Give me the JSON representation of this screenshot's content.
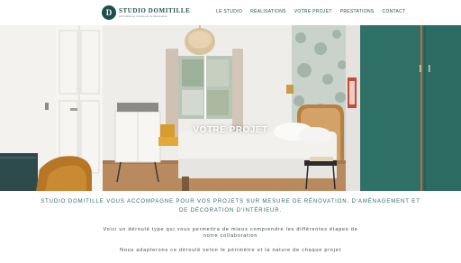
{
  "header": {
    "logo": {
      "initial": "D",
      "name": "STUDIO DOMITILLE",
      "tagline": "Architecture intérieure & décoration"
    },
    "nav": [
      {
        "label": "LE STUDIO"
      },
      {
        "label": "RÉALISATIONS"
      },
      {
        "label": "VOTRE PROJET"
      },
      {
        "label": "PRESTATIONS"
      },
      {
        "label": "CONTACT"
      }
    ]
  },
  "hero": {
    "title": "VOTRE PROJET"
  },
  "intro": {
    "lead_line1": "STUDIO DOMITILLE VOUS ACCOMPAGNE POUR VOS PROJETS SUR MESURE DE RÉNOVATION, D'AMÉNAGEMENT ET",
    "lead_line2": "DE DÉCORATION D'INTÉRIEUR.",
    "p1_line1": "Voici un déroulé type qui vous permettra de mieux comprendre les différentes étapes de",
    "p1_line2": "notre collaboration",
    "p2": "Nous adapterons ce déroulé selon le périmètre et la nature de chaque projet"
  },
  "colors": {
    "brand": "#1f4f49",
    "accent": "#2f6d66",
    "text": "#3d4a48"
  }
}
